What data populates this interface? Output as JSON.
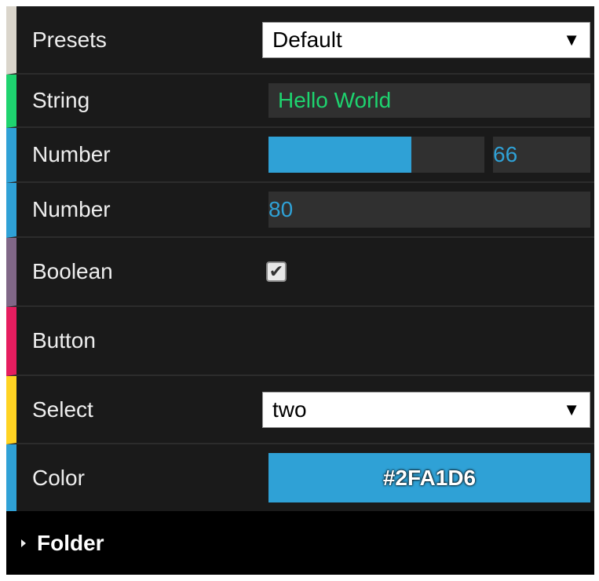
{
  "presets": {
    "label": "Presets",
    "value": "Default",
    "arrow": "▼"
  },
  "string": {
    "label": "String",
    "value": "Hello World"
  },
  "number_slider": {
    "label": "Number",
    "value": "66",
    "fraction": 0.66
  },
  "number_plain": {
    "label": "Number",
    "value": "80"
  },
  "boolean": {
    "label": "Boolean",
    "checked": true,
    "check_glyph": "✔"
  },
  "button": {
    "label": "Button"
  },
  "select": {
    "label": "Select",
    "value": "two",
    "arrow": "▼"
  },
  "color": {
    "label": "Color",
    "value": "#2FA1D6"
  },
  "folder": {
    "title": "Folder",
    "icon": "triangle-right-icon"
  },
  "colors": {
    "panel_bg": "#1a1a1a",
    "field_bg": "#303030",
    "accent_presets": "#dad5cb",
    "accent_string": "#1ed36f",
    "accent_number": "#2fa1d6",
    "accent_boolean": "#806787",
    "accent_button": "#e61d5f",
    "accent_select": "#ffd323",
    "accent_color": "#2fa1d6"
  }
}
